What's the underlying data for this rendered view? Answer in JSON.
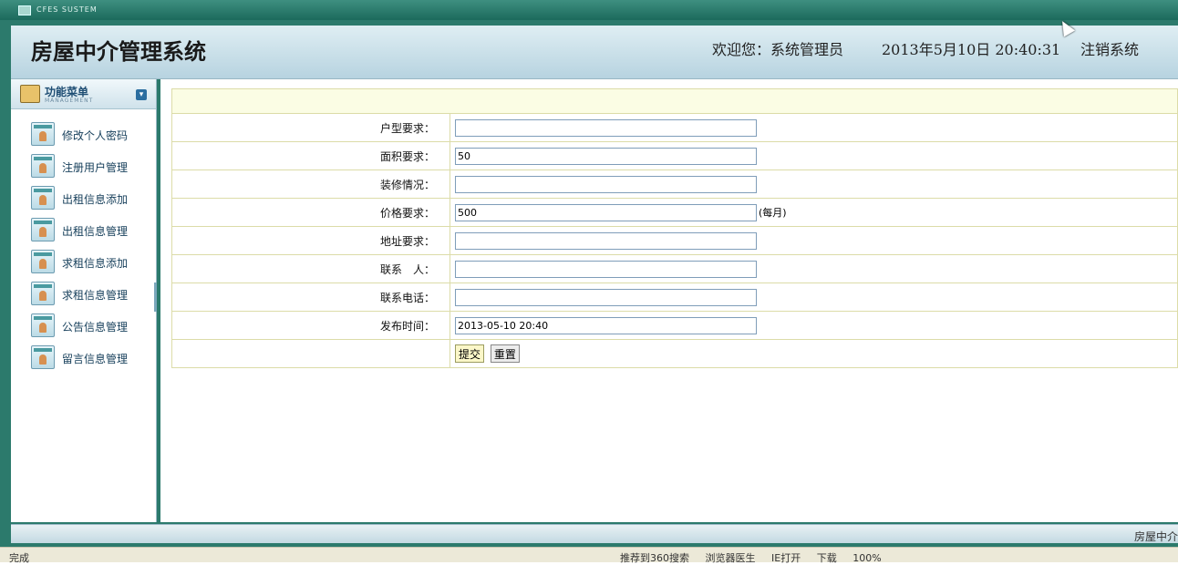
{
  "window": {
    "system_label": "CFES SUSTEM"
  },
  "header": {
    "title": "房屋中介管理系统",
    "welcome": "欢迎您：系统管理员",
    "datetime": "2013年5月10日  20:40:31",
    "logout": "注销系统"
  },
  "sidebar": {
    "menu_title": "功能菜单",
    "menu_subtitle": "MANAGEMENT",
    "items": [
      {
        "label": "修改个人密码"
      },
      {
        "label": "注册用户管理"
      },
      {
        "label": "出租信息添加"
      },
      {
        "label": "出租信息管理"
      },
      {
        "label": "求租信息添加"
      },
      {
        "label": "求租信息管理"
      },
      {
        "label": "公告信息管理"
      },
      {
        "label": "留言信息管理"
      }
    ]
  },
  "form": {
    "fields": [
      {
        "label": "户型要求：",
        "value": ""
      },
      {
        "label": "面积要求：",
        "value": "50"
      },
      {
        "label": "装修情况：",
        "value": ""
      },
      {
        "label": "价格要求：",
        "value": "500",
        "unit": "(每月)"
      },
      {
        "label": "地址要求：",
        "value": ""
      },
      {
        "label": "联系　人：",
        "value": ""
      },
      {
        "label": "联系电话：",
        "value": ""
      },
      {
        "label": "发布时间：",
        "value": "2013-05-10 20:40"
      }
    ],
    "submit": "提交",
    "reset": "重置"
  },
  "footer": {
    "text": "房屋中介"
  },
  "statusbar": {
    "status": "完成",
    "tools": [
      "推荐到360搜索",
      "浏览器医生",
      "IE打开",
      "下载",
      "100%"
    ]
  }
}
